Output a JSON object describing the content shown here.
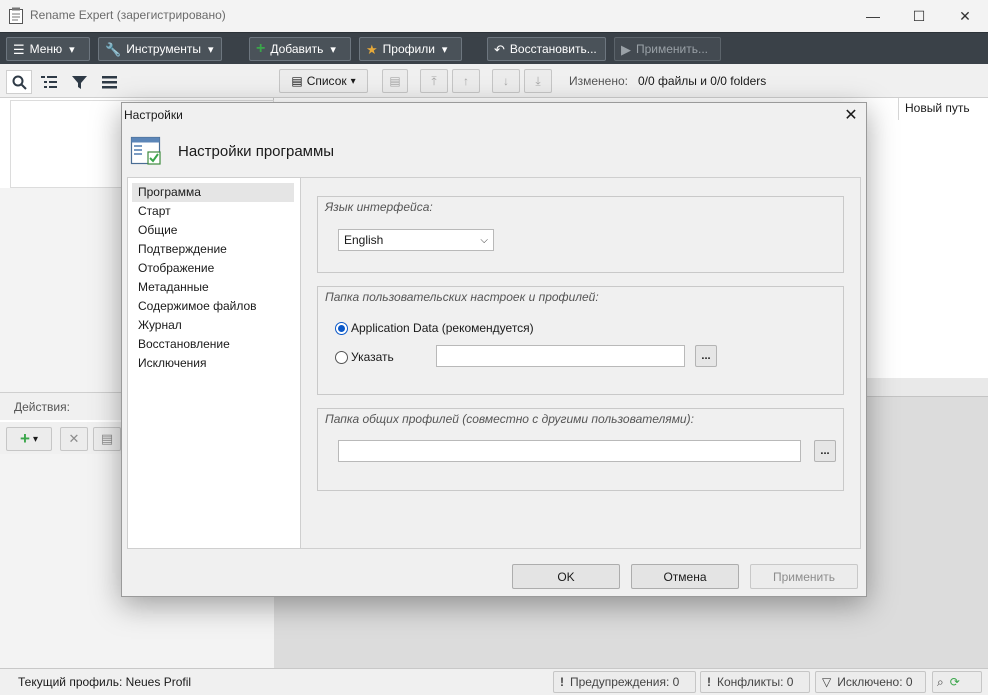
{
  "window": {
    "title": "Rename Expert (зарегистрировано)",
    "minimize_glyph": "—",
    "maximize_glyph": "☐",
    "close_glyph": "✕"
  },
  "toolbar": {
    "menu": {
      "label": "Меню",
      "icon": "hamburger-icon"
    },
    "tools": {
      "label": "Инструменты",
      "icon": "wrench-icon"
    },
    "add": {
      "label": "Добавить",
      "icon": "plus-icon"
    },
    "profiles": {
      "label": "Профили",
      "icon": "star-icon"
    },
    "restore": {
      "label": "Восстановить...",
      "icon": "undo-icon"
    },
    "apply": {
      "label": "Применить...",
      "icon": "play-icon"
    }
  },
  "left_pane": {
    "tools": [
      "search-icon",
      "tree-list-icon",
      "filter-icon",
      "lines-icon"
    ],
    "actions_label": "Действия:"
  },
  "right_pane": {
    "view_button": "Список",
    "changed_label": "Изменено:",
    "changed_value": "0/0 файлы и 0/0 folders",
    "column_new_path": "Новый путь"
  },
  "status": {
    "profile": "Текущий профиль: Neues Profil",
    "warnings": "Предупреждения: 0",
    "conflicts": "Конфликты: 0",
    "excluded": "Исключено: 0"
  },
  "dialog": {
    "title": "Настройки",
    "heading": "Настройки программы",
    "nav": [
      {
        "label": "Программа",
        "selected": true
      },
      {
        "label": "Старт"
      },
      {
        "label": "Общие"
      },
      {
        "label": "Подтверждение"
      },
      {
        "label": "Отображение"
      },
      {
        "label": "Метаданные"
      },
      {
        "label": "Содержимое файлов"
      },
      {
        "label": "Журнал"
      },
      {
        "label": "Восстановление"
      },
      {
        "label": "Исключения"
      }
    ],
    "language": {
      "group_title": "Язык интерфейса:",
      "value": "English"
    },
    "user_folder": {
      "group_title": "Папка пользовательских настроек и профилей:",
      "option_appdata": "Application Data (рекомендуется)",
      "option_custom": "Указать",
      "selected": "appdata",
      "path_value": "",
      "browse_label": "..."
    },
    "shared_folder": {
      "group_title": "Папка общих профилей (совместно с другими пользователями):",
      "path_value": "",
      "browse_label": "..."
    },
    "buttons": {
      "ok": "OK",
      "cancel": "Отмена",
      "apply": "Применить"
    }
  },
  "colors": {
    "toolbar_bg": "#3a4148",
    "accent_radio": "#0a58c8",
    "add_icon": "#3aa64a",
    "star_icon": "#e6a93a"
  }
}
